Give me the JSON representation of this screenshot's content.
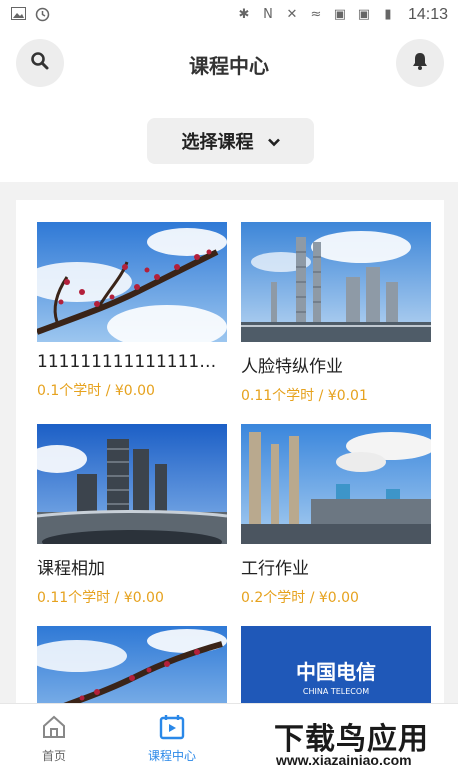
{
  "status_bar": {
    "time": "14:13"
  },
  "header": {
    "title": "课程中心",
    "select_label": "选择课程"
  },
  "courses": [
    {
      "title": "11111111111111111...",
      "meta": "0.1个学时 / ¥0.00",
      "image": "plum-blossom"
    },
    {
      "title": "人脸特纵作业",
      "meta": "0.11个学时 / ¥0.01",
      "image": "refinery"
    },
    {
      "title": "课程相加",
      "meta": "0.11个学时 / ¥0.00",
      "image": "factory"
    },
    {
      "title": "工行作业",
      "meta": "0.2个学时 / ¥0.00",
      "image": "chimneys"
    },
    {
      "image": "plum-blossom"
    },
    {
      "image": "china-telecom-logo",
      "logo_text": "中国电信",
      "logo_sub": "CHINA TELECOM"
    }
  ],
  "bottom_nav": {
    "items": [
      {
        "label": "首页",
        "icon": "home-icon",
        "active": false
      },
      {
        "label": "课程中心",
        "icon": "calendar-play-icon",
        "active": true
      }
    ]
  },
  "watermark": {
    "main": "下载鸟应用",
    "sub": "www.xiazainiao.com"
  },
  "colors": {
    "accent": "#2a88e8",
    "price": "#e6a21e"
  }
}
